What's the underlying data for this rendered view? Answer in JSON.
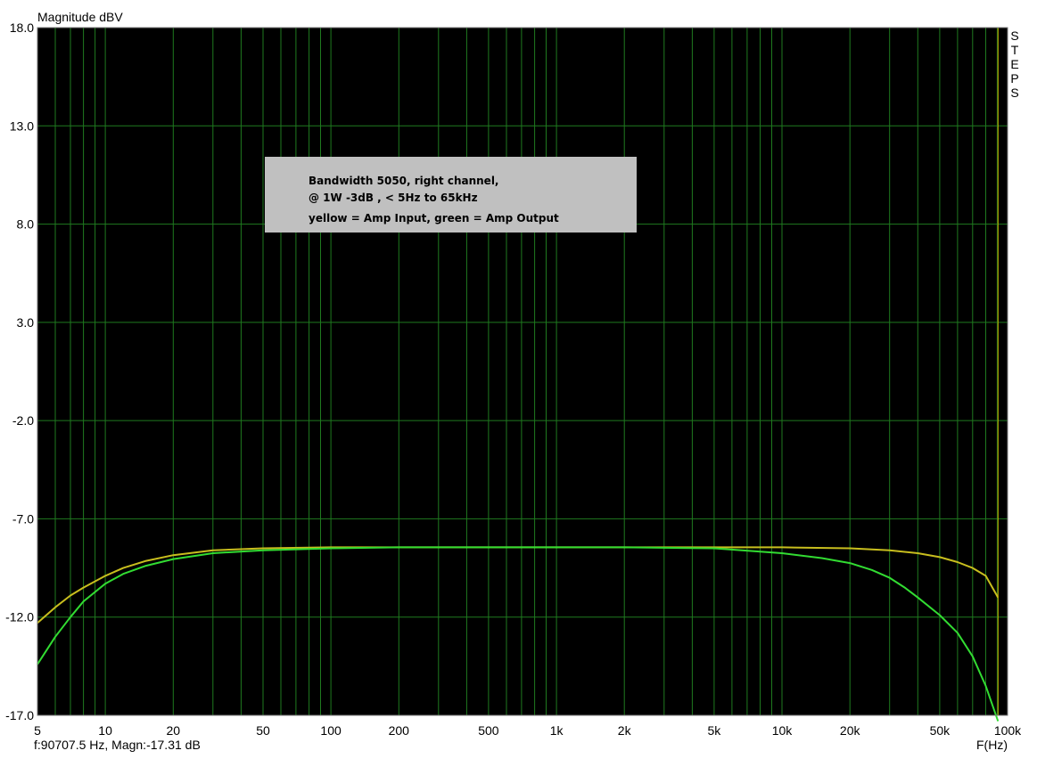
{
  "chart_data": {
    "type": "line",
    "title": "Magnitude dBV",
    "xlabel": "F(Hz)",
    "ylabel": "Magnitude dBV",
    "x_scale": "log",
    "xlim": [
      5,
      100000
    ],
    "ylim": [
      -17.0,
      18.0
    ],
    "grid": true,
    "x_tick_labels": [
      {
        "v": 5,
        "label": "5"
      },
      {
        "v": 10,
        "label": "10"
      },
      {
        "v": 20,
        "label": "20"
      },
      {
        "v": 50,
        "label": "50"
      },
      {
        "v": 100,
        "label": "100"
      },
      {
        "v": 200,
        "label": "200"
      },
      {
        "v": 500,
        "label": "500"
      },
      {
        "v": 1000,
        "label": "1k"
      },
      {
        "v": 2000,
        "label": "2k"
      },
      {
        "v": 5000,
        "label": "5k"
      },
      {
        "v": 10000,
        "label": "10k"
      },
      {
        "v": 20000,
        "label": "20k"
      },
      {
        "v": 50000,
        "label": "50k"
      },
      {
        "v": 100000,
        "label": "100k"
      }
    ],
    "y_tick_labels": [
      {
        "v": 18,
        "label": "18.0"
      },
      {
        "v": 13,
        "label": "13.0"
      },
      {
        "v": 8,
        "label": "8.0"
      },
      {
        "v": 3,
        "label": "3.0"
      },
      {
        "v": -2,
        "label": "-2.0"
      },
      {
        "v": -7,
        "label": "-7.0"
      },
      {
        "v": -12,
        "label": "-12.0"
      },
      {
        "v": -17,
        "label": "-17.0"
      }
    ],
    "side_label": "STEPS",
    "cursor": {
      "x": 90707.5,
      "color": "#c8b400"
    },
    "status_text": "f:90707.5 Hz, Magn:-17.31 dB",
    "annotation": {
      "lines": [
        "Bandwidth 5050, right channel,",
        "@ 1W -3dB ,  < 5Hz to 65kHz",
        "yellow = Amp Input, green = Amp Output"
      ]
    },
    "series": [
      {
        "color": "#c8be1e",
        "x": [
          5,
          6,
          7,
          8,
          10,
          12,
          15,
          20,
          30,
          50,
          100,
          200,
          500,
          1000,
          2000,
          5000,
          10000,
          20000,
          30000,
          40000,
          50000,
          60000,
          70000,
          80000,
          90700
        ],
        "y": [
          -12.3,
          -11.5,
          -10.9,
          -10.5,
          -9.9,
          -9.5,
          -9.15,
          -8.85,
          -8.6,
          -8.5,
          -8.45,
          -8.45,
          -8.45,
          -8.45,
          -8.45,
          -8.45,
          -8.45,
          -8.5,
          -8.6,
          -8.75,
          -8.95,
          -9.2,
          -9.5,
          -9.9,
          -11.0
        ]
      },
      {
        "color": "#32dc32",
        "x": [
          5,
          6,
          7,
          8,
          10,
          12,
          15,
          20,
          30,
          50,
          100,
          200,
          500,
          1000,
          2000,
          5000,
          10000,
          15000,
          20000,
          25000,
          30000,
          35000,
          40000,
          50000,
          60000,
          70000,
          80000,
          90700
        ],
        "y": [
          -14.4,
          -13.0,
          -12.0,
          -11.2,
          -10.3,
          -9.8,
          -9.4,
          -9.05,
          -8.75,
          -8.6,
          -8.5,
          -8.45,
          -8.45,
          -8.45,
          -8.45,
          -8.5,
          -8.75,
          -9.0,
          -9.25,
          -9.6,
          -10.0,
          -10.5,
          -11.0,
          -11.9,
          -12.8,
          -14.0,
          -15.5,
          -17.3
        ]
      }
    ]
  }
}
